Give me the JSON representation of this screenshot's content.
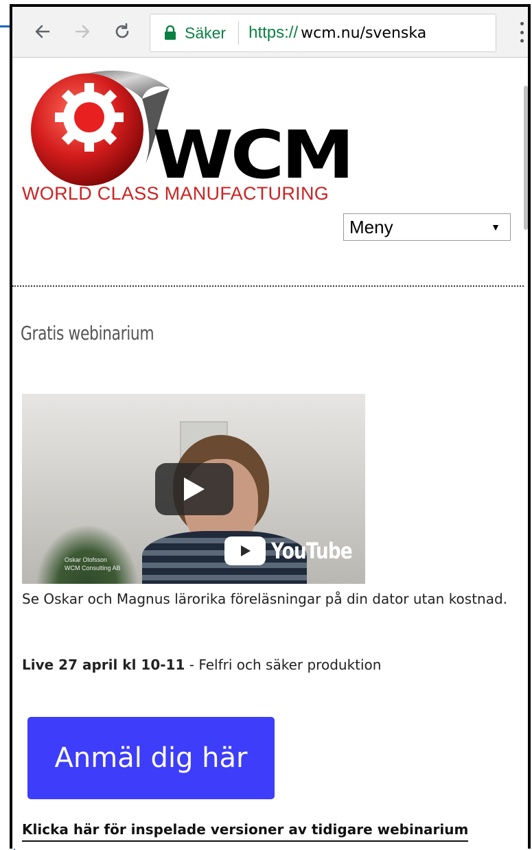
{
  "browser": {
    "secure_label": "Säker",
    "url_protocol": "https://",
    "url_host": "wcm.nu/svenska",
    "secure_color": "#0b8043"
  },
  "site": {
    "logo_wordmark": "WCM",
    "logo_tagline": "WORLD CLASS MANUFACTURING",
    "menu_selected": "Meny"
  },
  "content": {
    "heading": "Gratis webinarium",
    "video": {
      "platform_label": "YouTube",
      "caption_line1": "Oskar Olofsson",
      "caption_line2": "WCM Consulting AB"
    },
    "description": "Se Oskar och Magnus lärorika föreläsningar på din dator utan kostnad.",
    "live_bold": "Live 27 april kl 10-11",
    "live_rest": " - Felfri och säker produktion",
    "cta_label": "Anmäl dig här",
    "cta_color": "#3d3dfa",
    "recorded_link": "Klicka här för inspelade versioner av tidigare webinarium"
  }
}
